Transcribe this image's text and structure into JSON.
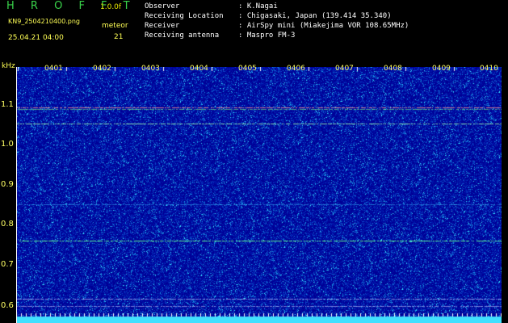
{
  "header": {
    "title": "H R O F F T",
    "version": "1.0.0f",
    "filename": "KN9_2504210400.png",
    "meteor_label": "meteor",
    "meteor_count": "21",
    "datetime": "25.04.21 04:00"
  },
  "metadata": [
    {
      "key": "Observer",
      "value": ": K.Nagai"
    },
    {
      "key": "Receiving Location",
      "value": ": Chigasaki, Japan (139.414 35.340)"
    },
    {
      "key": "Receiver",
      "value": ": AirSpy mini (Miakejima VOR 108.65MHz)"
    },
    {
      "key": "Receiving antenna",
      "value": ": Maspro FM-3"
    }
  ],
  "axis": {
    "unit": "kHz",
    "y_labels": [
      "1.1",
      "1.0",
      "0.9",
      "0.8",
      "0.7",
      "0.6"
    ],
    "x_labels": [
      "0401",
      "0402",
      "0403",
      "0404",
      "0405",
      "0406",
      "0407",
      "0408",
      "0409",
      "0410"
    ]
  },
  "colors": {
    "background": "#0000a0",
    "noise_low": "#1030c0",
    "noise_high": "#30e0ff",
    "bottom_band": "#40e0ff"
  }
}
